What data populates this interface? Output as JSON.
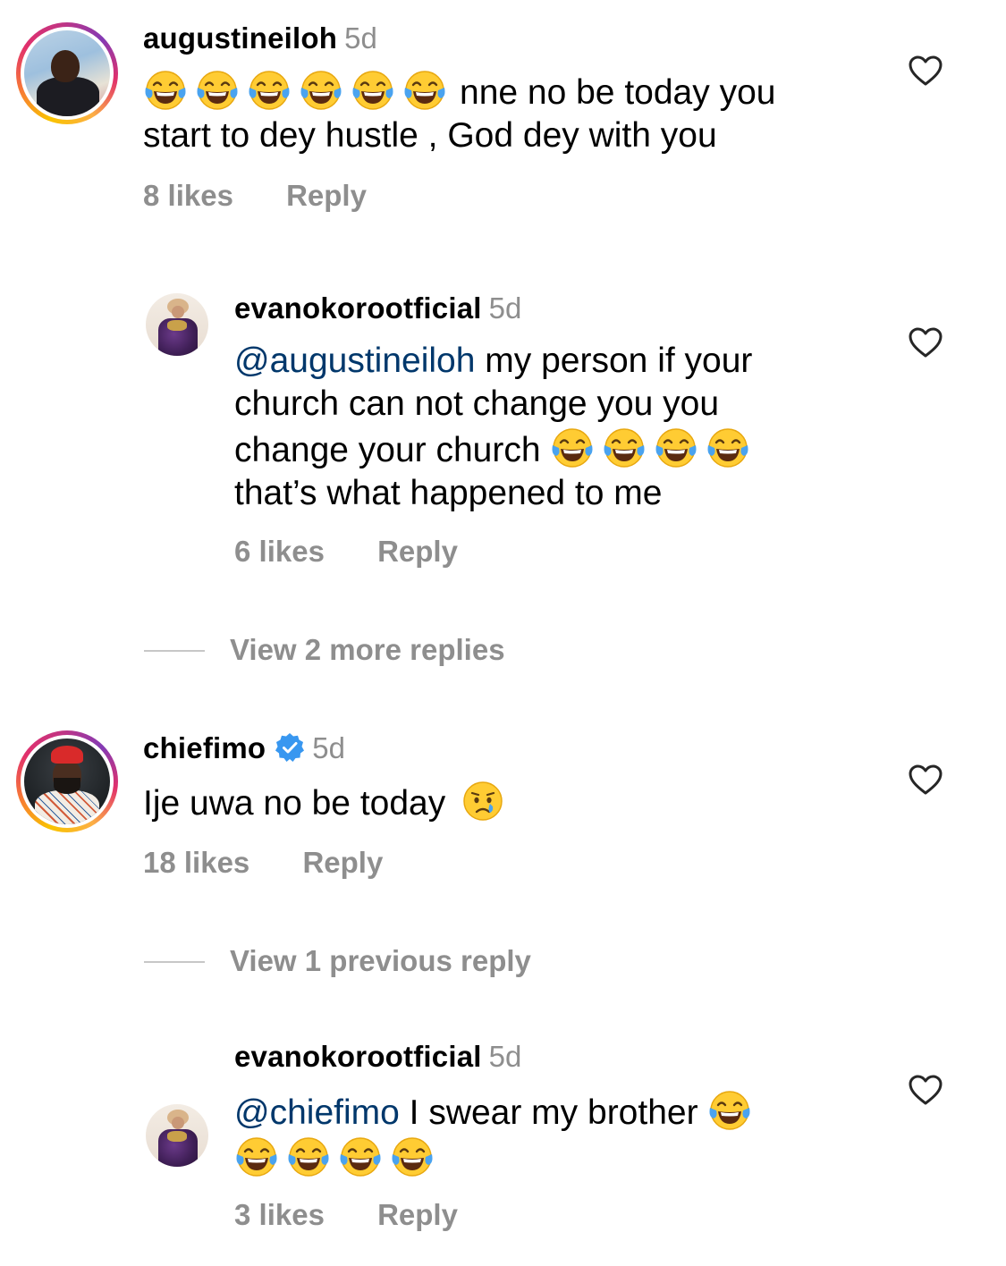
{
  "comments": [
    {
      "username": "augustineiloh",
      "time": "5d",
      "text_line1": "nne no be today you",
      "text_line2": "start to dey hustle , God dey with you",
      "likes": "8 likes",
      "reply": "Reply",
      "emoji": "face-with-tears-of-joy",
      "replies": [
        {
          "username": "evanokorootficial",
          "time": "5d",
          "mention": "@augustineiloh",
          "text_line1": " my person if your",
          "text_line2": "church can not change you you",
          "text_line3": "change your church ",
          "text_line4": "that’s what happened to me",
          "likes": "6 likes",
          "reply": "Reply"
        }
      ],
      "view_more": "View 2 more replies"
    },
    {
      "username": "chiefimo",
      "time": "5d",
      "verified": true,
      "text_line1": "Ije uwa no be today",
      "emoji": "crying-face",
      "likes": "18 likes",
      "reply": "Reply",
      "view_previous": "View 1 previous reply",
      "replies": [
        {
          "username": "evanokorootficial",
          "time": "5d",
          "mention": "@chiefimo",
          "text_line1": " I swear my brother ",
          "likes": "3 likes",
          "reply": "Reply"
        }
      ]
    }
  ],
  "colors": {
    "secondary_text": "#8e8e8e",
    "mention": "#00376b",
    "verified_badge": "#3897f0"
  },
  "icons": [
    "heart-outline-icon",
    "verified-badge-icon",
    "face-with-tears-of-joy",
    "crying-face"
  ]
}
